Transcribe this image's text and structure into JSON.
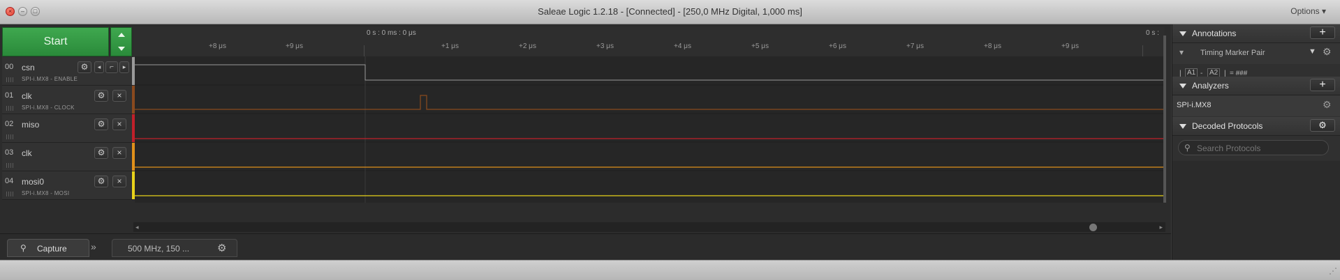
{
  "window": {
    "title": "Saleae Logic 1.2.18 - [Connected] - [250,0 MHz Digital, 1,000 ms]",
    "options_label": "Options ▾"
  },
  "start": {
    "label": "Start"
  },
  "timeline": {
    "origin_label": "0 s : 0 ms : 0 μs",
    "origin_label_right": "0 s :",
    "ticks": [
      "+8 μs",
      "+9 μs",
      "+1 μs",
      "+2 μs",
      "+3 μs",
      "+4 μs",
      "+5 μs",
      "+6 μs",
      "+7 μs",
      "+8 μs",
      "+9 μs"
    ]
  },
  "channels": [
    {
      "num": "00",
      "name": "csn",
      "sub": "SPI-i.MX8 - ENABLE",
      "color": "#9a9a9a"
    },
    {
      "num": "01",
      "name": "clk",
      "sub": "SPI-i.MX8 - CLOCK",
      "color": "#8a4a1e"
    },
    {
      "num": "02",
      "name": "miso",
      "sub": "",
      "color": "#c0202a"
    },
    {
      "num": "03",
      "name": "clk",
      "sub": "",
      "color": "#e0901a"
    },
    {
      "num": "04",
      "name": "mosi0",
      "sub": "SPI-i.MX8 - MOSI",
      "color": "#e8d21a"
    }
  ],
  "bottom": {
    "capture_label": "Capture",
    "settings_label": "500 MHz, 150 ..."
  },
  "annotations": {
    "title": "Annotations",
    "add": "+",
    "marker_pair": "Timing Marker Pair",
    "a1": "A1",
    "dash": "-",
    "a2": "A2",
    "pipe": "|",
    "equals": "= ###"
  },
  "analyzers": {
    "title": "Analyzers",
    "add": "+",
    "items": [
      "SPI-i.MX8"
    ]
  },
  "decoded": {
    "title": "Decoded Protocols",
    "search_placeholder": "Search Protocols"
  }
}
